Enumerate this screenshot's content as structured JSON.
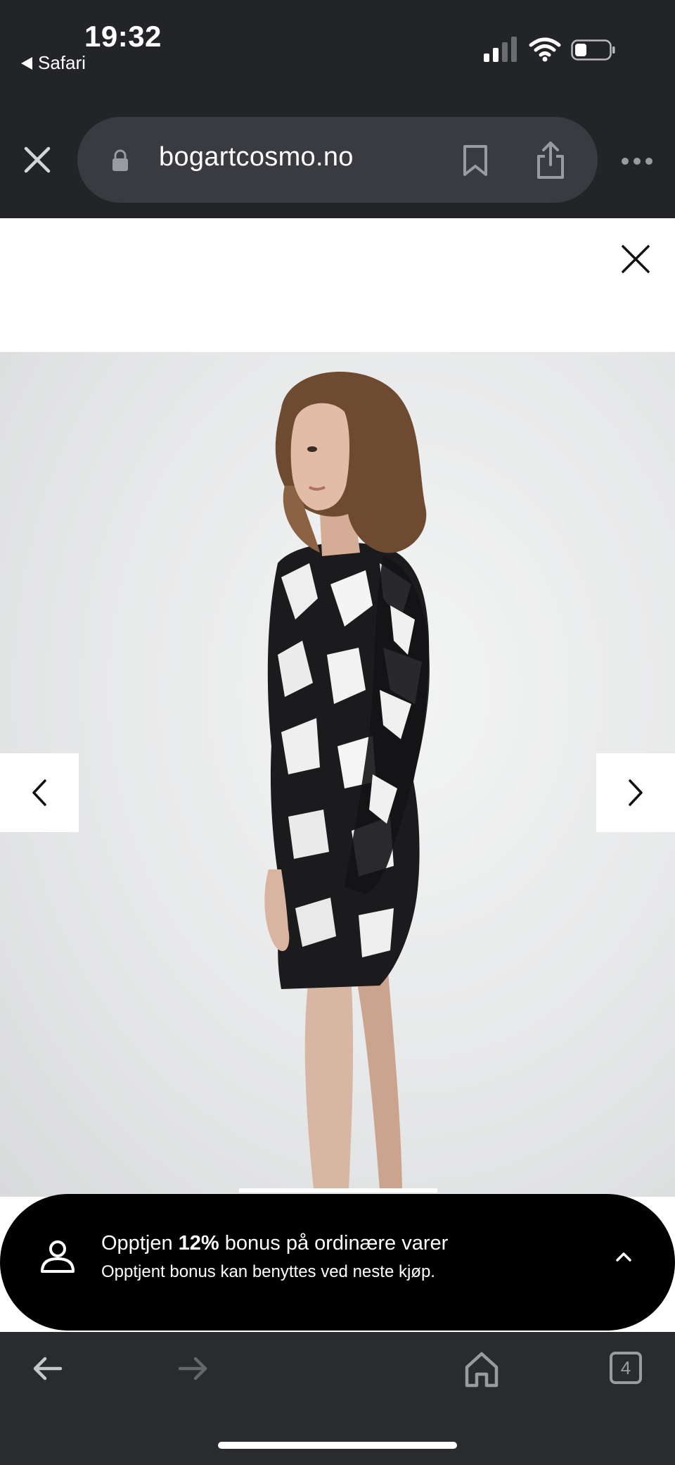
{
  "status_bar": {
    "time": "19:32",
    "back_app": "Safari",
    "signal_bars": 4,
    "signal_bars_active": 2,
    "battery_level": 0.3
  },
  "browser": {
    "url": "bogartcosmo.no",
    "close_icon": "close-icon",
    "lock_icon": "lock-icon",
    "bookmark_icon": "bookmark-icon",
    "share_icon": "share-icon",
    "more_icon": "ellipsis-icon"
  },
  "gallery": {
    "close_icon": "close-icon",
    "prev_icon": "chevron-left-icon",
    "next_icon": "chevron-right-icon",
    "image_subject": "model wearing black and white printed long-sleeve mini dress, side view"
  },
  "bonus_banner": {
    "title_prefix": "Opptjen ",
    "title_bold": "12%",
    "title_suffix": " bonus på ordinære varer",
    "subtitle": "Opptjent bonus kan benyttes ved neste kjøp.",
    "icon": "user-icon",
    "toggle_icon": "chevron-up-icon"
  },
  "toolbar": {
    "tab_count": "4",
    "back_icon": "arrow-left-icon",
    "forward_icon": "arrow-right-icon",
    "home_icon": "home-icon"
  },
  "colors": {
    "chrome_bg": "#232428",
    "pill_bg": "#3a3b40",
    "banner_bg": "#000000",
    "toolbar_bg": "#2a2b2f"
  }
}
